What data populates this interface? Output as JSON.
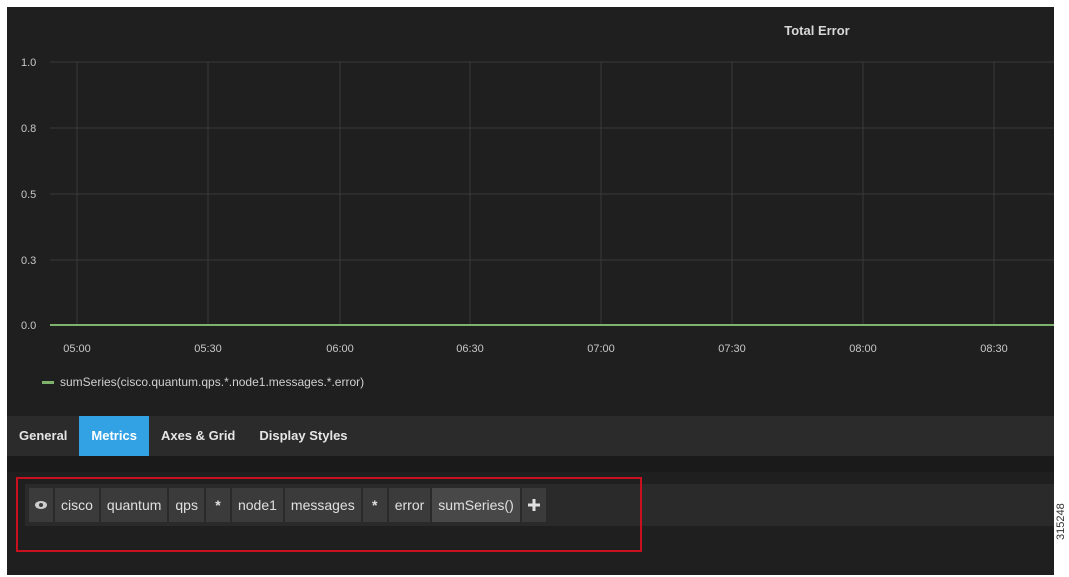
{
  "panel": {
    "title": "Total Error"
  },
  "chart_data": {
    "type": "line",
    "title": "Total Error",
    "x": [
      "05:00",
      "05:30",
      "06:00",
      "06:30",
      "07:00",
      "07:30",
      "08:00",
      "08:30"
    ],
    "y_ticks": [
      "1.0",
      "0.8",
      "0.5",
      "0.3",
      "0.0"
    ],
    "ylim": [
      0,
      1.0
    ],
    "grid": true,
    "series": [
      {
        "name": "sumSeries(cisco.quantum.qps.*.node1.messages.*.error)",
        "values": [
          0,
          0,
          0,
          0,
          0,
          0,
          0,
          0
        ]
      }
    ],
    "colors": {
      "series": "#7eb26d",
      "grid": "#3a3a3a"
    }
  },
  "legend": {
    "label": "sumSeries(cisco.quantum.qps.*.node1.messages.*.error)"
  },
  "tabs": [
    {
      "label": "General",
      "active": false
    },
    {
      "label": "Metrics",
      "active": true
    },
    {
      "label": "Axes & Grid",
      "active": false
    },
    {
      "label": "Display Styles",
      "active": false
    }
  ],
  "query": {
    "eye_icon": "eye-icon",
    "segments": [
      "cisco",
      "quantum",
      "qps",
      "*",
      "node1",
      "messages",
      "*",
      "error"
    ],
    "function": "sumSeries()",
    "add_icon": "plus-icon"
  },
  "watermark": "315248",
  "colors": {
    "accent": "#33a2e5",
    "highlight": "#c8101e",
    "background": "#1f1f1f"
  }
}
